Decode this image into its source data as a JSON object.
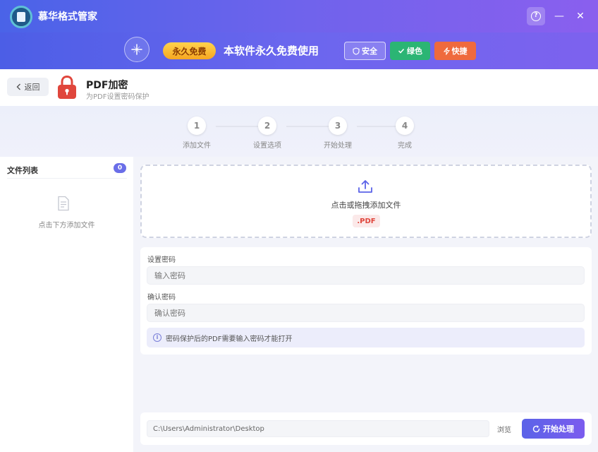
{
  "app": {
    "title": "慕华格式管家"
  },
  "window": {
    "help_icon": "?",
    "minimize_icon": "—",
    "close_icon": "✕"
  },
  "banner": {
    "sparkle_icon": "sparkle-icon",
    "badge": "永久免费",
    "text": "本软件永久免费使用",
    "tags": [
      {
        "label": "安全",
        "icon": "shield-icon"
      },
      {
        "label": "绿色",
        "icon": "check-icon"
      },
      {
        "label": "快捷",
        "icon": "bolt-icon"
      }
    ]
  },
  "header": {
    "back_label": "返回",
    "title": "PDF加密",
    "subtitle": "为PDF设置密码保护"
  },
  "steps": [
    {
      "number": "1",
      "label": "添加文件"
    },
    {
      "number": "2",
      "label": "设置选项"
    },
    {
      "number": "3",
      "label": "开始处理"
    },
    {
      "number": "4",
      "label": "完成"
    }
  ],
  "sidebar": {
    "title": "文件列表",
    "count": "0",
    "empty_text": "点击下方添加文件"
  },
  "dropzone": {
    "text": "点击或拖拽添加文件",
    "format": ".PDF"
  },
  "form": {
    "password_label": "设置密码",
    "password_placeholder": "输入密码",
    "confirm_label": "确认密码",
    "confirm_placeholder": "确认密码",
    "hint": "密码保护后的PDF需要输入密码才能打开"
  },
  "footer": {
    "output_path": "C:\\Users\\Administrator\\Desktop",
    "browse_label": "浏览",
    "start_label": "开始处理"
  },
  "colors": {
    "accent": "#6a6ee8",
    "badge_gold": "#f6a621",
    "green": "#2bb574",
    "orange": "#ef6a3d",
    "lock_red": "#e0463c"
  }
}
